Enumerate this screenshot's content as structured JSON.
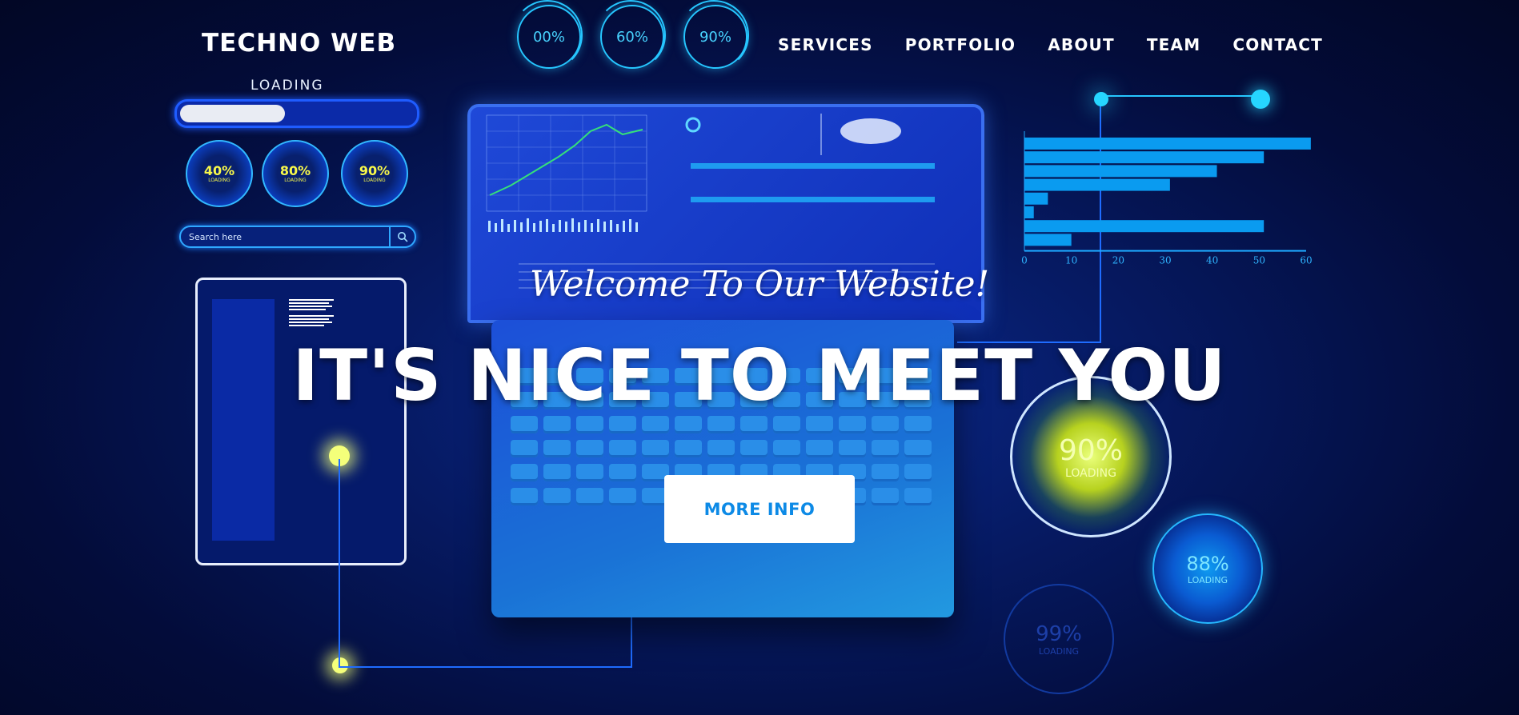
{
  "brand": "TECHNO WEB",
  "nav": [
    "SERVICES",
    "PORTFOLIO",
    "ABOUT",
    "TEAM",
    "CONTACT"
  ],
  "top_rings": [
    "00%",
    "60%",
    "90%"
  ],
  "loading": {
    "label": "LOADING",
    "progress": 0.45
  },
  "small_gauges": [
    {
      "pct": "40%",
      "label": "LOADING"
    },
    {
      "pct": "80%",
      "label": "LOADING"
    },
    {
      "pct": "90%",
      "label": "LOADING"
    }
  ],
  "search": {
    "placeholder": "Search here"
  },
  "hero": {
    "welcome": "Welcome To Our Website!",
    "title": "IT'S NICE TO MEET YOU",
    "button": "MORE INFO"
  },
  "right_gauges": [
    {
      "pct": "90%",
      "label": "LOADING"
    },
    {
      "pct": "88%",
      "label": "LOADING"
    },
    {
      "pct": "99%",
      "label": "LOADING"
    }
  ],
  "chart_data": {
    "type": "bar",
    "orientation": "horizontal",
    "values": [
      61,
      51,
      41,
      31,
      5,
      2,
      51,
      10
    ],
    "xticks": [
      "0",
      "10",
      "20",
      "30",
      "40",
      "50",
      "60"
    ],
    "xlim": [
      0,
      60
    ],
    "color": "#0a9bf0"
  },
  "colors": {
    "accent": "#26c6ff",
    "glow_yellow": "#f4ff7a",
    "button_text": "#0d8ae6"
  }
}
